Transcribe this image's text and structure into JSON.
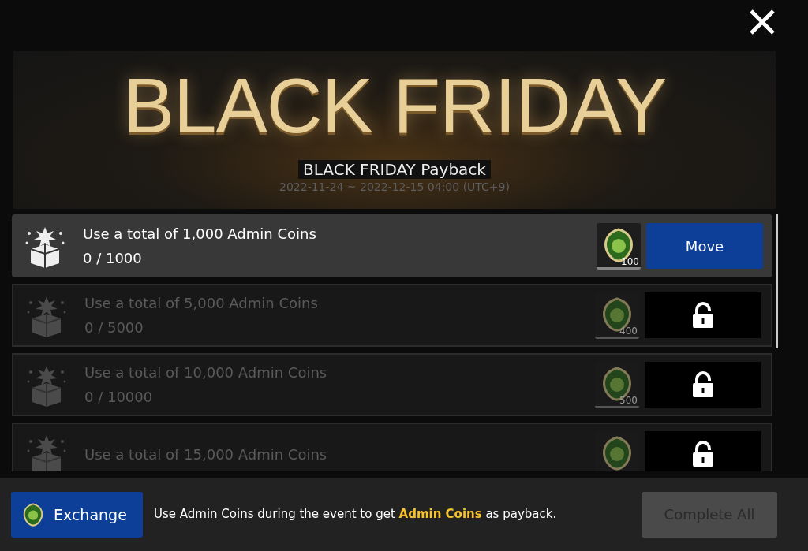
{
  "banner": {
    "headline": "BLACK FRIDAY",
    "subtitle": "BLACK FRIDAY Payback",
    "period": "2022-11-24 ~ 2022-12-15 04:00 (UTC+9)"
  },
  "missions": [
    {
      "title": "Use a total of 1,000 Admin Coins",
      "progress": "0 / 1000",
      "reward": "100",
      "locked": false,
      "action": "Move"
    },
    {
      "title": "Use a total of 5,000 Admin Coins",
      "progress": "0 / 5000",
      "reward": "400",
      "locked": true
    },
    {
      "title": "Use a total of 10,000 Admin Coins",
      "progress": "0 / 10000",
      "reward": "500",
      "locked": true
    },
    {
      "title": "Use a total of 15,000 Admin Coins",
      "locked": true
    }
  ],
  "footer": {
    "exchange_button": "Exchange",
    "note": "Use Admin Coins during the event to get **Admin Coins** as payback.",
    "complete_all": {
      "label": "Complete All",
      "disabled": true
    }
  }
}
